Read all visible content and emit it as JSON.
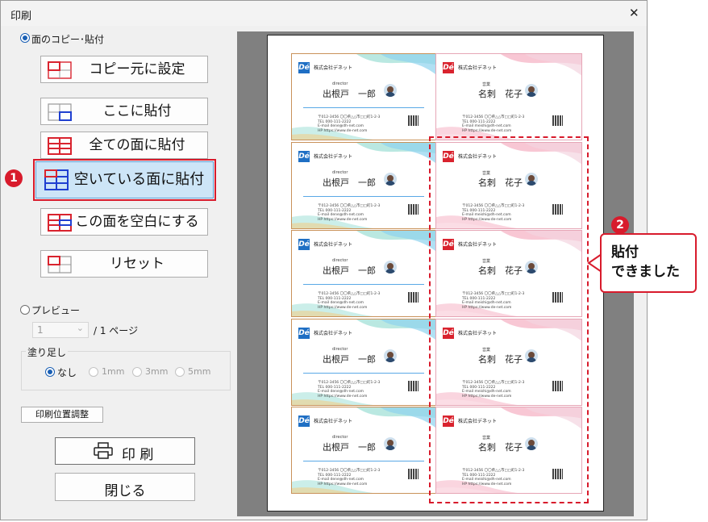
{
  "window": {
    "title": "印刷",
    "close_glyph": "✕"
  },
  "mode": {
    "paste_label": "面のコピー･貼付",
    "paste_selected": true,
    "preview_label": "プレビュー",
    "preview_selected": false
  },
  "buttons": {
    "copy_source": "コピー元に設定",
    "paste_here": "ここに貼付",
    "paste_all": "全ての面に貼付",
    "paste_empty": "空いている面に貼付",
    "clear_face": "この面を空白にする",
    "reset": "リセット"
  },
  "page_select": {
    "value": "1",
    "suffix": "/ 1 ページ"
  },
  "bleed": {
    "label": "塗り足し",
    "options": [
      "なし",
      "1mm",
      "3mm",
      "5mm"
    ],
    "selected": "なし"
  },
  "print_position_label": "印刷位置調整",
  "print_label": "印 刷",
  "close_label": "閉じる",
  "annotation": {
    "step1": "1",
    "step2": "2",
    "callout_line1": "貼付",
    "callout_line2": "できました"
  },
  "card_left": {
    "logo": "Dé",
    "company": "株式会社デネット",
    "role": "director",
    "name": "出根戸　一郎",
    "info": [
      "〒012-3456 〇〇県△△市□□町1-2-3",
      "TEL 000-111-2222",
      "E-mail dene@dh-net.com",
      "HP https://www.de-net.com"
    ]
  },
  "card_right": {
    "logo": "Dé",
    "company": "株式会社デネット",
    "role": "営業",
    "name": "名刺　花子",
    "info": [
      "〒012-3456 〇〇県△△市□□町1-2-3",
      "TEL 000-111-2222",
      "E-mail meishi@dh-net.com",
      "HP https://www.de-net.com"
    ]
  },
  "colors": {
    "accent_red": "#d81b2c",
    "select_blue": "#1a5fb4",
    "icon_red": "#d9232e",
    "icon_blue": "#1f3fd0"
  }
}
